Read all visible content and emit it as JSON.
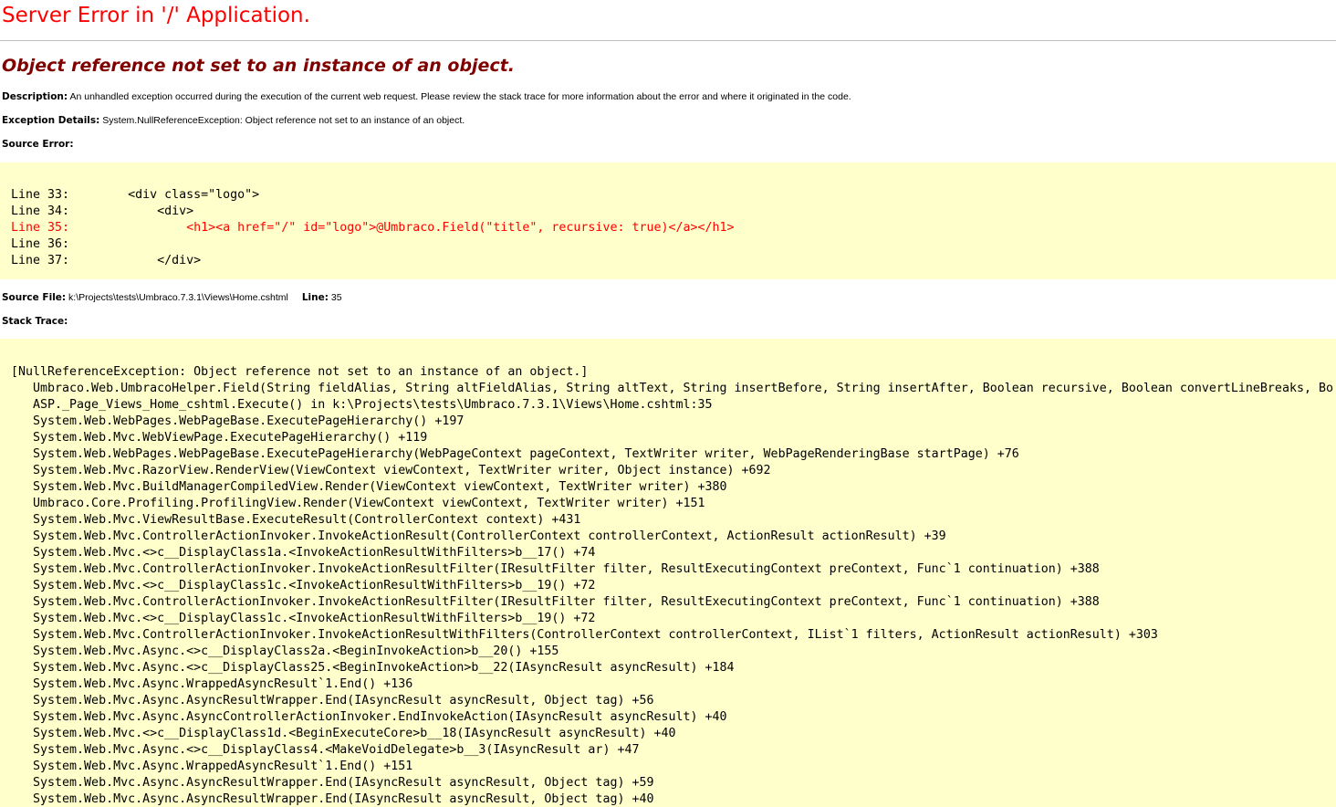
{
  "page": {
    "title": "Server Error in '/' Application.",
    "error_message": "Object reference not set to an instance of an object."
  },
  "description": {
    "label": "Description:",
    "text": " An unhandled exception occurred during the execution of the current web request. Please review the stack trace for more information about the error and where it originated in the code."
  },
  "exception_details": {
    "label": "Exception Details:",
    "text": " System.NullReferenceException: Object reference not set to an instance of an object."
  },
  "source_error": {
    "label": "Source Error:",
    "lines": [
      {
        "text": "Line 33:        <div class=\"logo\">",
        "is_error": false
      },
      {
        "text": "Line 34:            <div>",
        "is_error": false
      },
      {
        "text": "Line 35:                <h1><a href=\"/\" id=\"logo\">@Umbraco.Field(\"title\", recursive: true)</a></h1>",
        "is_error": true
      },
      {
        "text": "Line 36:",
        "is_error": false
      },
      {
        "text": "Line 37:            </div>",
        "is_error": false
      }
    ]
  },
  "source_file": {
    "label": "Source File:",
    "path": " k:\\Projects\\tests\\Umbraco.7.3.1\\Views\\Home.cshtml",
    "line_label": "Line:",
    "line_value": " 35"
  },
  "stack_trace": {
    "label": "Stack Trace:",
    "lines": [
      "[NullReferenceException: Object reference not set to an instance of an object.]",
      "   Umbraco.Web.UmbracoHelper.Field(String fieldAlias, String altFieldAlias, String altText, String insertBefore, String insertAfter, Boolean recursive, Boolean convertLineBreaks, Bo",
      "   ASP._Page_Views_Home_cshtml.Execute() in k:\\Projects\\tests\\Umbraco.7.3.1\\Views\\Home.cshtml:35",
      "   System.Web.WebPages.WebPageBase.ExecutePageHierarchy() +197",
      "   System.Web.Mvc.WebViewPage.ExecutePageHierarchy() +119",
      "   System.Web.WebPages.WebPageBase.ExecutePageHierarchy(WebPageContext pageContext, TextWriter writer, WebPageRenderingBase startPage) +76",
      "   System.Web.Mvc.RazorView.RenderView(ViewContext viewContext, TextWriter writer, Object instance) +692",
      "   System.Web.Mvc.BuildManagerCompiledView.Render(ViewContext viewContext, TextWriter writer) +380",
      "   Umbraco.Core.Profiling.ProfilingView.Render(ViewContext viewContext, TextWriter writer) +151",
      "   System.Web.Mvc.ViewResultBase.ExecuteResult(ControllerContext context) +431",
      "   System.Web.Mvc.ControllerActionInvoker.InvokeActionResult(ControllerContext controllerContext, ActionResult actionResult) +39",
      "   System.Web.Mvc.<>c__DisplayClass1a.<InvokeActionResultWithFilters>b__17() +74",
      "   System.Web.Mvc.ControllerActionInvoker.InvokeActionResultFilter(IResultFilter filter, ResultExecutingContext preContext, Func`1 continuation) +388",
      "   System.Web.Mvc.<>c__DisplayClass1c.<InvokeActionResultWithFilters>b__19() +72",
      "   System.Web.Mvc.ControllerActionInvoker.InvokeActionResultFilter(IResultFilter filter, ResultExecutingContext preContext, Func`1 continuation) +388",
      "   System.Web.Mvc.<>c__DisplayClass1c.<InvokeActionResultWithFilters>b__19() +72",
      "   System.Web.Mvc.ControllerActionInvoker.InvokeActionResultWithFilters(ControllerContext controllerContext, IList`1 filters, ActionResult actionResult) +303",
      "   System.Web.Mvc.Async.<>c__DisplayClass2a.<BeginInvokeAction>b__20() +155",
      "   System.Web.Mvc.Async.<>c__DisplayClass25.<BeginInvokeAction>b__22(IAsyncResult asyncResult) +184",
      "   System.Web.Mvc.Async.WrappedAsyncResult`1.End() +136",
      "   System.Web.Mvc.Async.AsyncResultWrapper.End(IAsyncResult asyncResult, Object tag) +56",
      "   System.Web.Mvc.Async.AsyncControllerActionInvoker.EndInvokeAction(IAsyncResult asyncResult) +40",
      "   System.Web.Mvc.<>c__DisplayClass1d.<BeginExecuteCore>b__18(IAsyncResult asyncResult) +40",
      "   System.Web.Mvc.Async.<>c__DisplayClass4.<MakeVoidDelegate>b__3(IAsyncResult ar) +47",
      "   System.Web.Mvc.Async.WrappedAsyncResult`1.End() +151",
      "   System.Web.Mvc.Async.AsyncResultWrapper.End(IAsyncResult asyncResult, Object tag) +59",
      "   System.Web.Mvc.Async.AsyncResultWrapper.End(IAsyncResult asyncResult, Object tag) +40"
    ]
  },
  "colors": {
    "title": "#ff0000",
    "error_message": "#800000",
    "code_background": "#ffffcc",
    "error_line": "#ff0000"
  }
}
